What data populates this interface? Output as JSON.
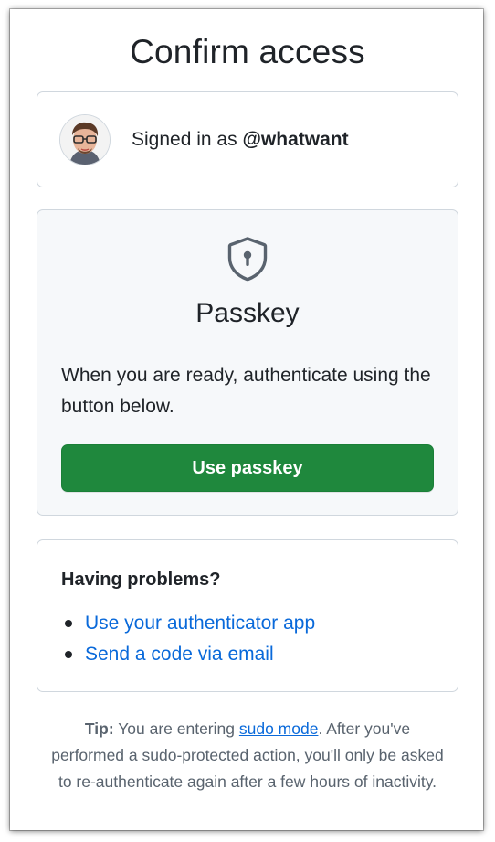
{
  "page": {
    "title": "Confirm access"
  },
  "user": {
    "signed_in_prefix": "Signed in as",
    "username": "@whatwant"
  },
  "passkey": {
    "icon": "shield-lock-icon",
    "title": "Passkey",
    "description": "When you are ready, authenticate using the button below.",
    "button_label": "Use passkey"
  },
  "problems": {
    "title": "Having problems?",
    "links": [
      "Use your authenticator app",
      "Send a code via email"
    ]
  },
  "tip": {
    "label": "Tip:",
    "text_before": "You are entering",
    "link": "sudo mode",
    "text_after": ". After you've performed a sudo-protected action, you'll only be asked to re-authenticate again after a few hours of inactivity."
  },
  "colors": {
    "primary_button": "#1f883d",
    "link": "#0969da",
    "border": "#d0d7de",
    "passkey_card_bg": "#f6f8fa"
  }
}
